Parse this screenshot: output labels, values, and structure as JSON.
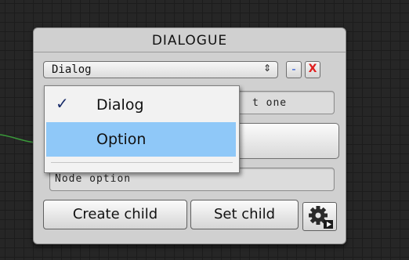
{
  "node": {
    "title": "DIALOGUE",
    "type_popup": {
      "value": "Dialog",
      "arrows_glyph": "⇕"
    },
    "minus_button_label": "-",
    "close_button_label": "X",
    "name_field_value": "t one",
    "option_field_value": "Node option",
    "create_child_label": "Create child",
    "set_child_label": "Set child",
    "settings_icon": "gear-icon"
  },
  "dropdown": {
    "items": [
      {
        "label": "Dialog",
        "checked": true
      },
      {
        "label": "Option",
        "highlighted": true
      }
    ],
    "check_glyph": "✓"
  },
  "colors": {
    "canvas_bg": "#262626",
    "node_bg": "#d0d0d0",
    "highlight": "#8fc8f8",
    "connection": "#3a9a3a",
    "close_red": "#e02020",
    "minus_blue": "#2856d6"
  }
}
